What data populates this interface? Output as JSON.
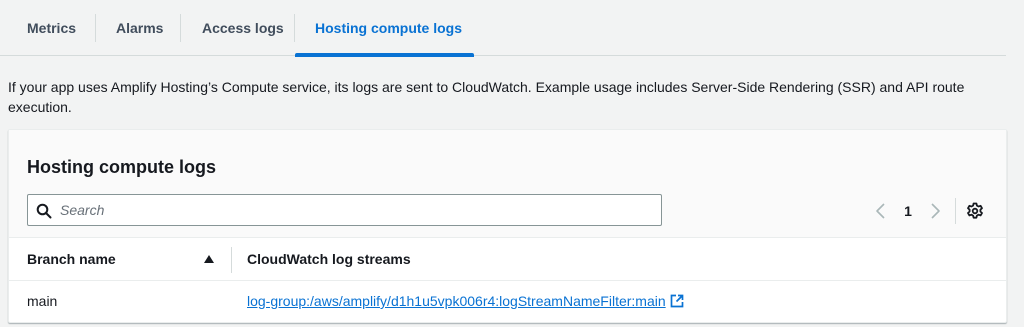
{
  "tabs": [
    {
      "label": "Metrics",
      "active": false
    },
    {
      "label": "Alarms",
      "active": false
    },
    {
      "label": "Access logs",
      "active": false
    },
    {
      "label": "Hosting compute logs",
      "active": true
    }
  ],
  "description": "If your app uses Amplify Hosting’s Compute service, its logs are sent to CloudWatch. Example usage includes Server-Side Rendering (SSR) and API route execution.",
  "panel": {
    "title": "Hosting compute logs",
    "search": {
      "placeholder": "Search",
      "value": "",
      "icon": "search-icon"
    },
    "pagination": {
      "current_page": "1",
      "prev_icon": "chevron-left-icon",
      "next_icon": "chevron-right-icon"
    },
    "settings_icon": "gear-icon",
    "table": {
      "columns": [
        {
          "label": "Branch name",
          "sort": "ascending"
        },
        {
          "label": "CloudWatch log streams"
        }
      ],
      "rows": [
        {
          "branch": "main",
          "log_stream": "log-group:/aws/amplify/d1h1u5vpk006r4:logStreamNameFilter:main",
          "link_icon": "external-link-icon"
        }
      ]
    }
  },
  "colors": {
    "accent": "#0972d3",
    "text": "#16191f",
    "muted": "#414d5c",
    "border": "#d5dbdb",
    "background": "#f2f3f3"
  }
}
